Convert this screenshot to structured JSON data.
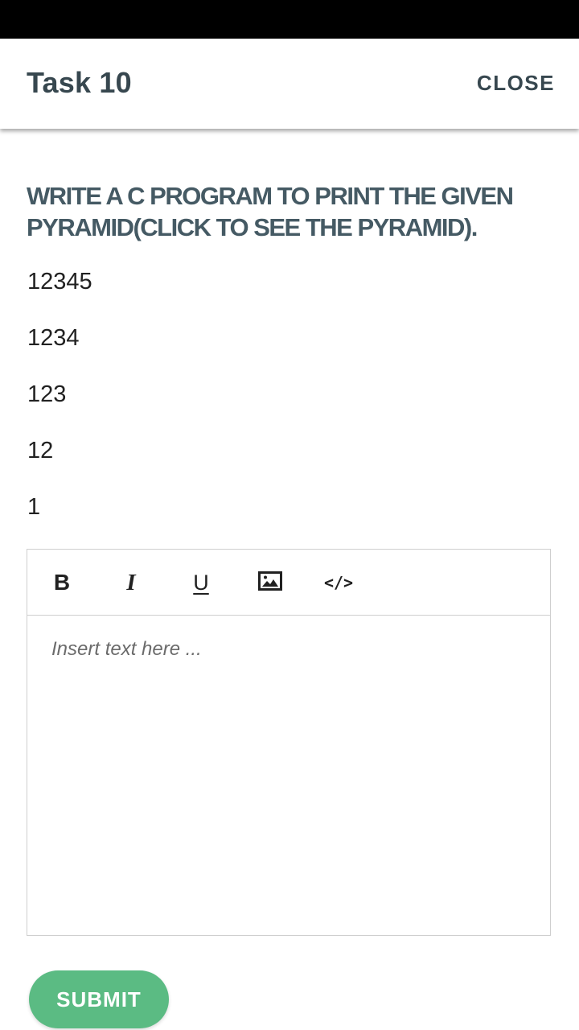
{
  "app_bar": {
    "title": "Task 10",
    "close_label": "CLOSE"
  },
  "question": {
    "text": "WRITE A C PROGRAM TO PRINT THE GIVEN PYRAMID(CLICK TO SEE THE PYRAMID)."
  },
  "pyramid": [
    "12345",
    "1234",
    "123",
    "12",
    "1"
  ],
  "editor": {
    "toolbar": {
      "bold": "B",
      "italic": "I",
      "underline": "U",
      "code": "</>"
    },
    "placeholder": "Insert text here ...",
    "value": ""
  },
  "submit_label": "SUBMIT",
  "colors": {
    "accent": "#5bbb83",
    "title_text": "#37474f",
    "question_text": "#455a64"
  },
  "icons": {
    "image": "image-icon",
    "code": "code-icon"
  }
}
